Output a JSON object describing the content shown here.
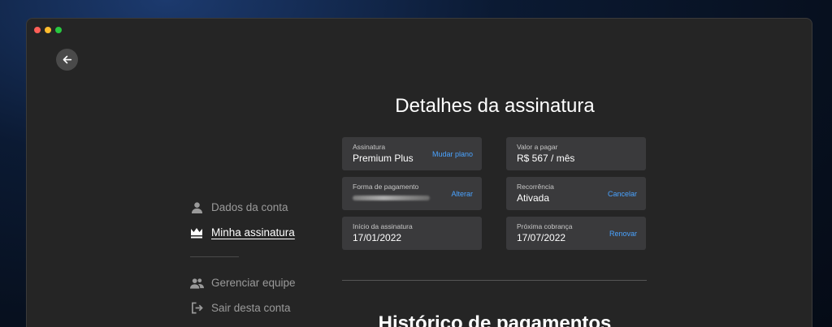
{
  "window": {
    "controls": [
      "close",
      "minimize",
      "zoom"
    ]
  },
  "nav": {
    "back_icon": "arrow-left-icon"
  },
  "sidebar": {
    "items": [
      {
        "label": "Dados da conta",
        "icon": "user-icon",
        "active": false
      },
      {
        "label": "Minha assinatura",
        "icon": "crown-icon",
        "active": true
      },
      {
        "label": "Gerenciar equipe",
        "icon": "team-icon",
        "active": false
      },
      {
        "label": "Sair desta conta",
        "icon": "logout-icon",
        "active": false
      }
    ]
  },
  "main": {
    "title": "Detalhes da assinatura",
    "cards": {
      "subscription": {
        "label": "Assinatura",
        "value": "Premium Plus",
        "action": "Mudar plano"
      },
      "amount": {
        "label": "Valor a pagar",
        "value": "R$ 567 / mês"
      },
      "payment": {
        "label": "Forma de pagamento",
        "value": "",
        "action": "Alterar"
      },
      "recurrence": {
        "label": "Recorrência",
        "value": "Ativada",
        "action": "Cancelar"
      },
      "start": {
        "label": "Início da assinatura",
        "value": "17/01/2022"
      },
      "next_charge": {
        "label": "Próxima cobrança",
        "value": "17/07/2022",
        "action": "Renovar"
      }
    },
    "history_title": "Histórico de pagamentos"
  },
  "colors": {
    "accent": "#4aa3ff",
    "window_bg": "#252525",
    "card_bg": "#3a3a3c"
  }
}
